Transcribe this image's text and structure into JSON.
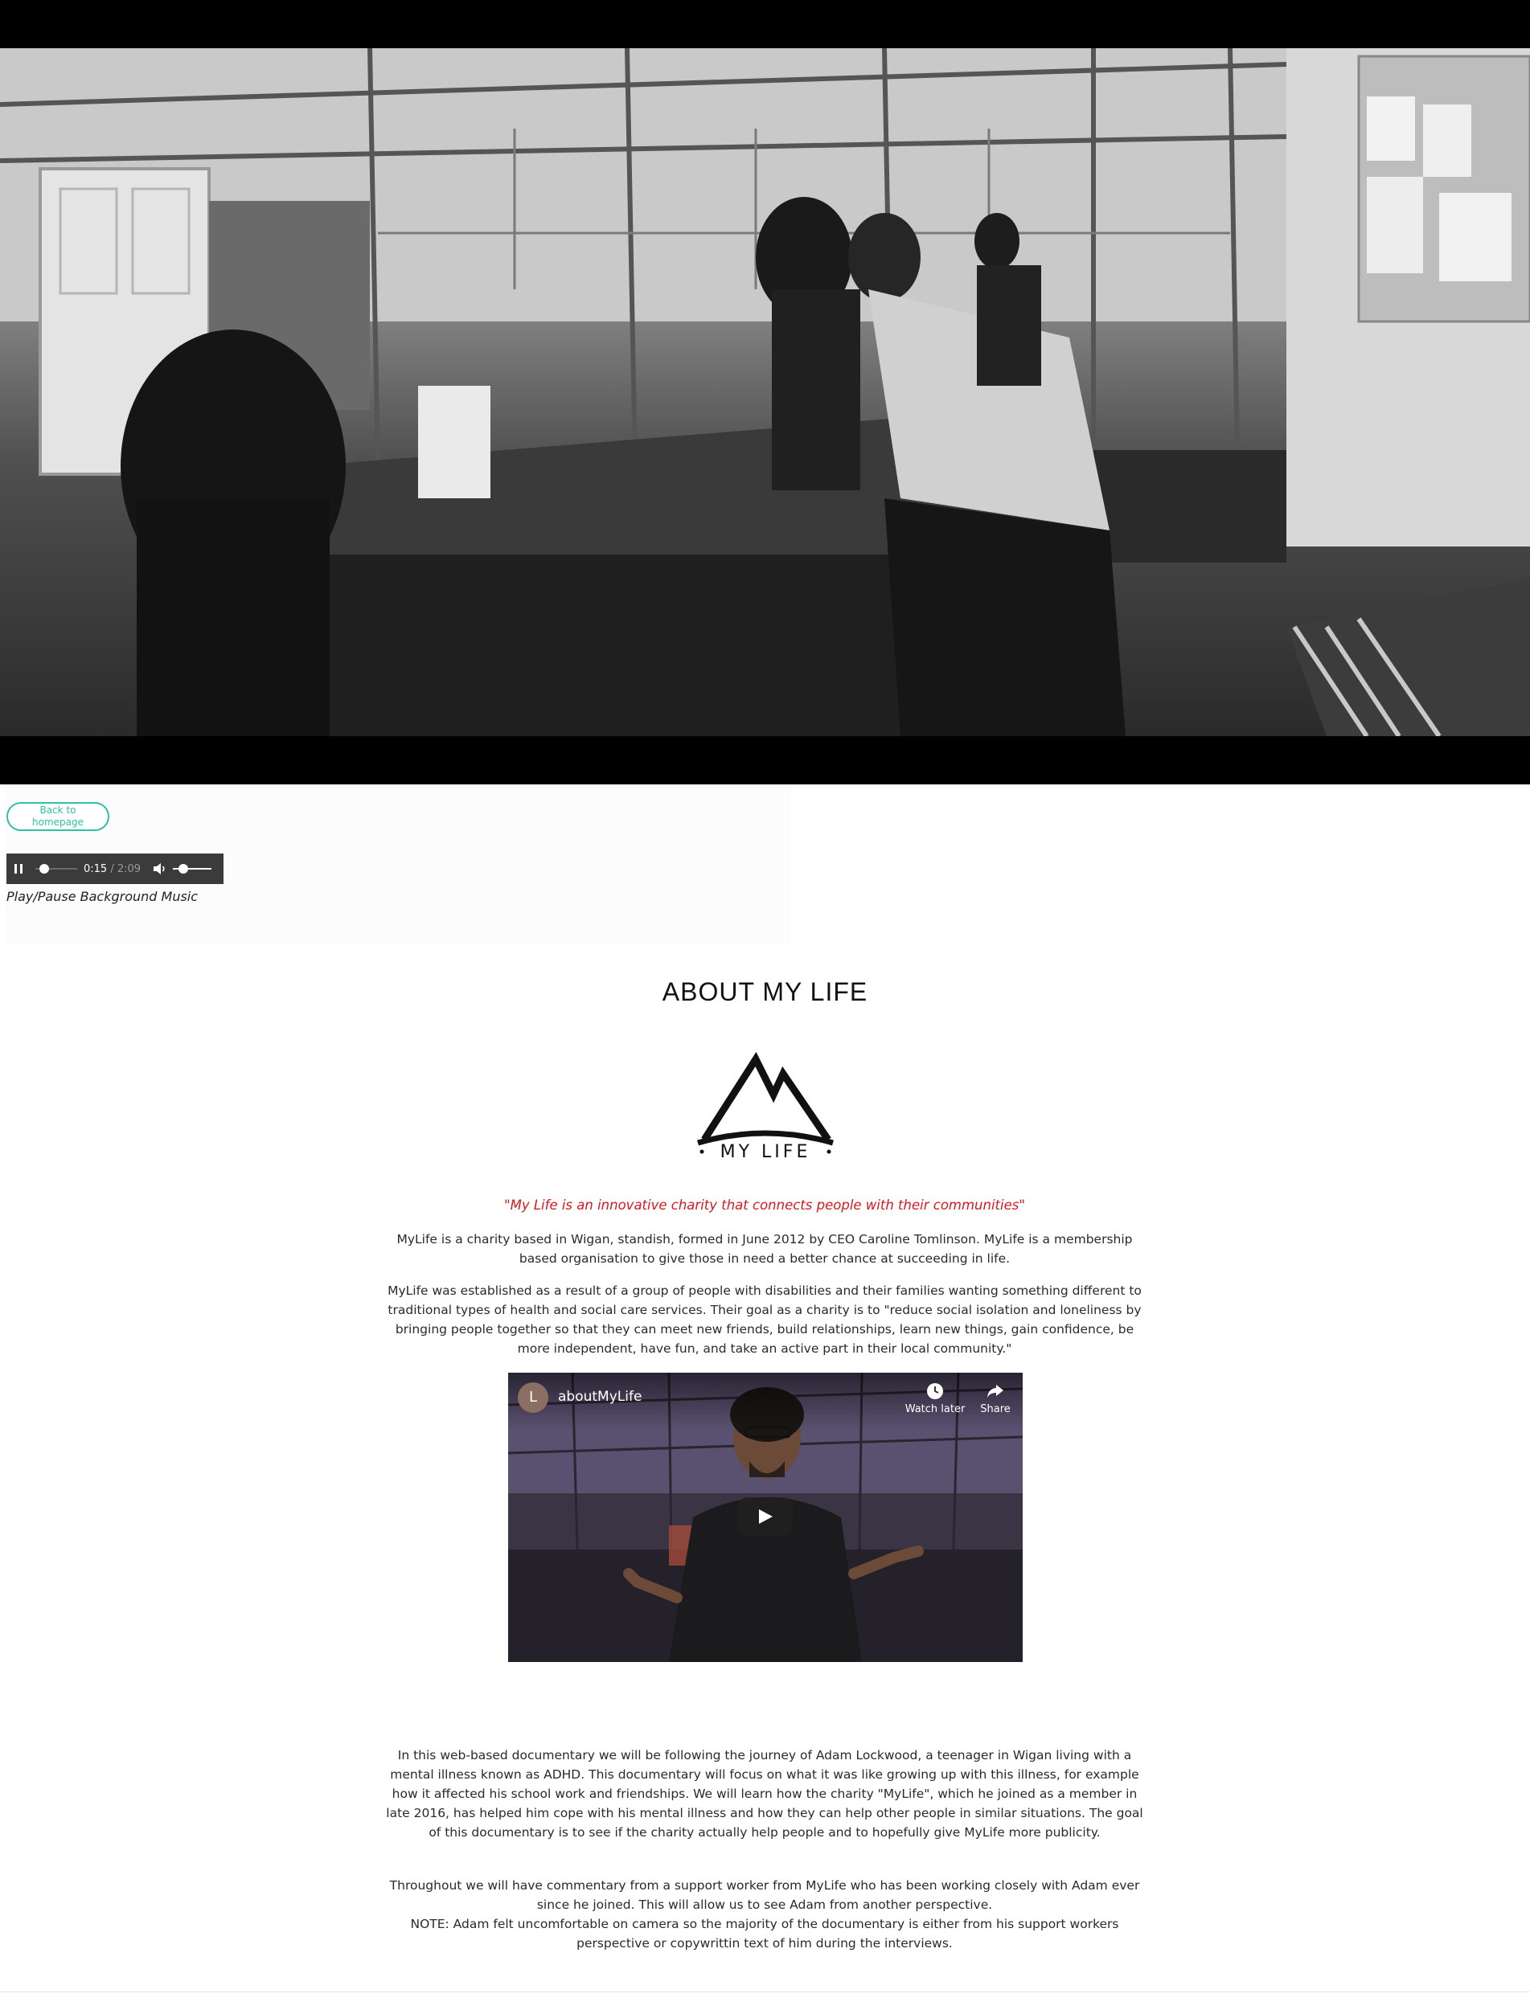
{
  "hero": {
    "icon": "workshop-video-scene"
  },
  "controls": {
    "back_button_label": "Back to\nhomepage",
    "audio": {
      "current_time": "0:15",
      "duration": "/ 2:09",
      "progress": 0.12,
      "volume": 0.2,
      "state": "playing"
    },
    "caption": "Play/Pause Background Music"
  },
  "about": {
    "title": "ABOUT MY LIFE",
    "logo_text": "MY LIFE",
    "tagline": "\"My Life is an innovative charity that connects people with their communities\"",
    "paragraphs": [
      "MyLife is a charity based in Wigan, standish, formed in June 2012 by CEO Caroline Tomlinson. MyLife is a membership based organisation to give those in need a better chance at succeeding in life.",
      "MyLife was established as a result of a group of people with disabilities and their families wanting something different to traditional types of health and social care services. Their goal as a charity is to \"reduce social isolation and loneliness by bringing people together so that they can meet new friends, build relationships, learn new things, gain confidence, be more independent, have fun, and take an active part in their local community.\""
    ],
    "video": {
      "channel_initial": "L",
      "title": "aboutMyLife",
      "watch_later_label": "Watch later",
      "share_label": "Share"
    },
    "documentary": [
      "In this web-based documentary we will be following the journey of Adam Lockwood, a teenager in Wigan living with a mental illness known as ADHD. This documentary will focus on what it was like growing up with this illness, for example how it affected his school work and friendships. We will learn how the charity \"MyLife\", which he joined as a member in late 2016, has helped him cope with his mental illness and how they can help other people in similar situations. The goal of this documentary is to see if the charity actually help people and to hopefully give MyLife more publicity.",
      "Throughout we will have commentary from a support worker from MyLife who has been working closely with Adam ever since he joined. This will allow us to see Adam from another perspective.",
      "NOTE: Adam felt uncomfortable on camera so the majority of the documentary is either from his support workers perspective or copywrittin text of him during the interviews."
    ]
  },
  "colors": {
    "accent": "#2fc2a0",
    "tagline": "#d71920",
    "player_bg": "#3b3b3b"
  }
}
